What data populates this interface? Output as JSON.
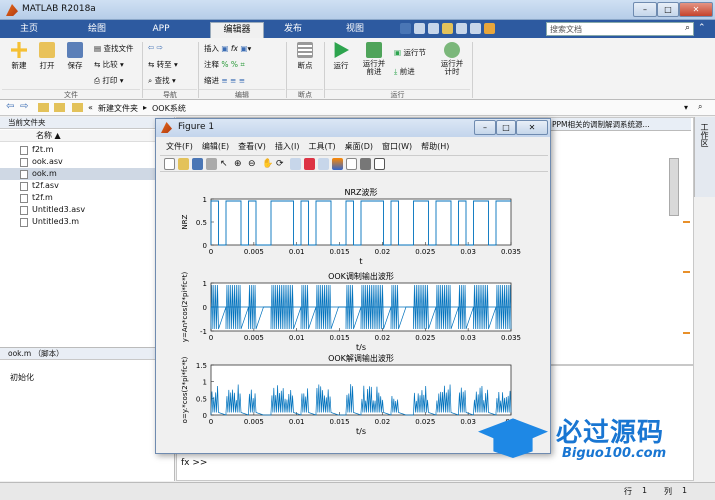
{
  "app": {
    "title": "MATLAB R2018a",
    "search_placeholder": "搜索文档"
  },
  "tabs": [
    {
      "label": "主页",
      "active": false
    },
    {
      "label": "绘图",
      "active": false
    },
    {
      "label": "APP",
      "active": false
    },
    {
      "label": "编辑器",
      "active": true
    },
    {
      "label": "发布",
      "active": false
    },
    {
      "label": "视图",
      "active": false
    }
  ],
  "ribbon": {
    "file": {
      "new": "新建",
      "open": "打开",
      "save": "保存",
      "find_files": "查找文件",
      "compare": "比较",
      "print": "打印",
      "group": "文件"
    },
    "nav": {
      "goto": "转至",
      "find": "查找",
      "group": "导航"
    },
    "edit": {
      "insert": "插入",
      "comment": "注释",
      "indent": "缩进",
      "fx": "fx",
      "group": "编辑"
    },
    "breakpoints": {
      "label": "断点",
      "group": "断点"
    },
    "run": {
      "run": "运行",
      "run_advance": "运行并\n前进",
      "run_section": "运行节",
      "advance": "前进",
      "run_time": "运行并\n计时",
      "group": "运行"
    }
  },
  "address": {
    "path1": "新建文件夹",
    "path2": "OOK系统",
    "sep": "▸",
    "lead": "«"
  },
  "current_folder": {
    "title": "当前文件夹",
    "col_name": "名称 ▲",
    "files": [
      "f2t.m",
      "ook.asv",
      "ook.m",
      "t2f.asv",
      "t2f.m",
      "Untitled3.asv",
      "Untitled3.m"
    ],
    "selected": "ook.m"
  },
  "details": {
    "title": "ook.m （脚本）",
    "text": "初始化"
  },
  "editor_tab_text": "PPM相关的调制解调系统源...",
  "workspace_label": "工作区",
  "command": {
    "prompt": "fx >>"
  },
  "status": {
    "row_label": "行",
    "row": "1",
    "col_label": "列",
    "col": "1"
  },
  "watermark": {
    "text": "必过源码",
    "url": "Biguo100.com"
  },
  "figure": {
    "title": "Figure 1",
    "menu": [
      "文件(F)",
      "编辑(E)",
      "查看(V)",
      "插入(I)",
      "工具(T)",
      "桌面(D)",
      "窗口(W)",
      "帮助(H)"
    ],
    "plots": [
      {
        "title": "NRZ波形",
        "ylabel": "NRZ",
        "xlabel": "t",
        "ylim": [
          0,
          1
        ],
        "yticks": [
          "1",
          "0.5",
          "0"
        ]
      },
      {
        "title": "OOK调制输出波形",
        "ylabel": "y=An*cos(2*pi*fc*t)",
        "xlabel": "t/s",
        "ylim": [
          -1,
          1
        ],
        "yticks": [
          "1",
          "0",
          "-1"
        ]
      },
      {
        "title": "OOK解调输出波形",
        "ylabel": "o=y.*cos(2*pi*fc*t)",
        "xlabel": "t/s",
        "ylim": [
          0,
          1.5
        ],
        "yticks": [
          "1.5",
          "1",
          "0.5",
          "0"
        ]
      }
    ],
    "xticks": [
      "0",
      "0.005",
      "0.01",
      "0.015",
      "0.02",
      "0.025",
      "0.03",
      "0.035"
    ],
    "xlast_partial": "0.0",
    "line_color": "#0072bd"
  },
  "chart_data": [
    {
      "type": "line",
      "title": "NRZ波形",
      "xlabel": "t",
      "ylabel": "NRZ",
      "xlim": [
        0,
        0.035
      ],
      "ylim": [
        0,
        1
      ],
      "series": [
        {
          "values": [
            1,
            0,
            1,
            1,
            0,
            1,
            0,
            0,
            1,
            1,
            1,
            0,
            1,
            0,
            1,
            1,
            0,
            0,
            1,
            0,
            1,
            1,
            1,
            0,
            1,
            0,
            0,
            1,
            1,
            0,
            1,
            1,
            0,
            1,
            0,
            1,
            1,
            0,
            1,
            1
          ]
        }
      ]
    },
    {
      "type": "line",
      "title": "OOK调制输出波形",
      "xlabel": "t/s",
      "ylabel": "y=An*cos(2*pi*fc*t)",
      "xlim": [
        0,
        0.035
      ],
      "ylim": [
        -1,
        1
      ]
    },
    {
      "type": "line",
      "title": "OOK解调输出波形",
      "xlabel": "t/s",
      "ylabel": "o=y.*cos(2*pi*fc*t)",
      "xlim": [
        0,
        0.035
      ],
      "ylim": [
        0,
        1.5
      ]
    }
  ]
}
